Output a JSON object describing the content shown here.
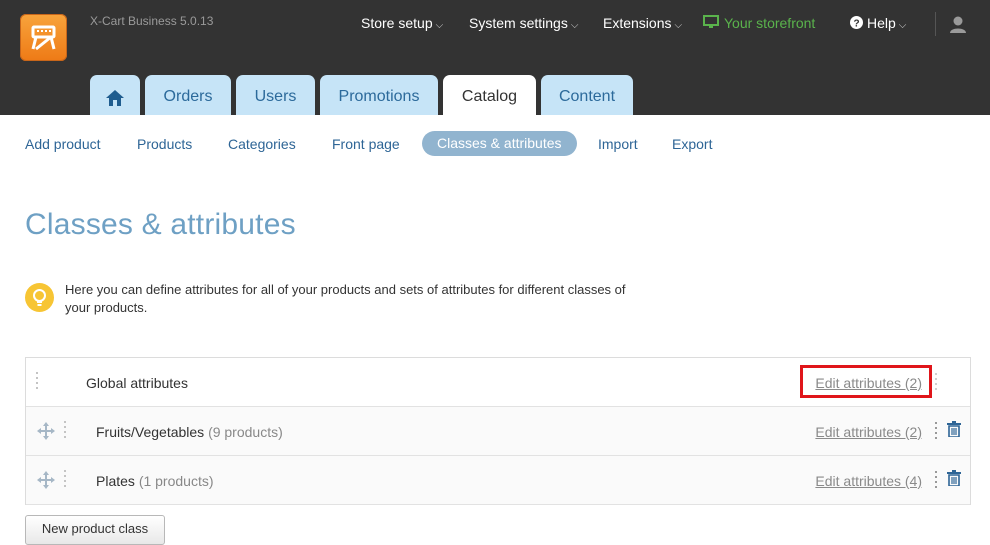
{
  "app": {
    "version": "X-Cart Business 5.0.13"
  },
  "top_nav": {
    "store_setup": "Store setup",
    "system_settings": "System settings",
    "extensions": "Extensions",
    "storefront": "Your storefront",
    "help": "Help",
    "caret": "⌵",
    "storefront_color": "#5ab34c"
  },
  "tabs": [
    {
      "label": "",
      "icon": "home-icon"
    },
    {
      "label": "Orders"
    },
    {
      "label": "Users"
    },
    {
      "label": "Promotions"
    },
    {
      "label": "Catalog",
      "active": true
    },
    {
      "label": "Content"
    }
  ],
  "sub_nav": [
    {
      "label": "Add product"
    },
    {
      "label": "Products"
    },
    {
      "label": "Categories"
    },
    {
      "label": "Front page"
    },
    {
      "label": "Classes & attributes",
      "active": true
    },
    {
      "label": "Import"
    },
    {
      "label": "Export"
    }
  ],
  "page": {
    "title": "Classes & attributes",
    "intro": "Here you can define attributes for all of your products and sets of attributes for different classes of your products."
  },
  "classes": [
    {
      "name": "Global attributes",
      "count": "",
      "edit_label": "Edit attributes (2)"
    },
    {
      "name": "Fruits/Vegetables",
      "count": "(9 products)",
      "edit_label": "Edit attributes (2)"
    },
    {
      "name": "Plates",
      "count": "(1 products)",
      "edit_label": "Edit attributes (4)"
    }
  ],
  "actions": {
    "new_class": "New product class"
  },
  "colors": {
    "header_bg": "#333333",
    "accent": "#6ea0c4",
    "tab_bg": "#c6e4f7",
    "highlight": "#e0151a"
  }
}
